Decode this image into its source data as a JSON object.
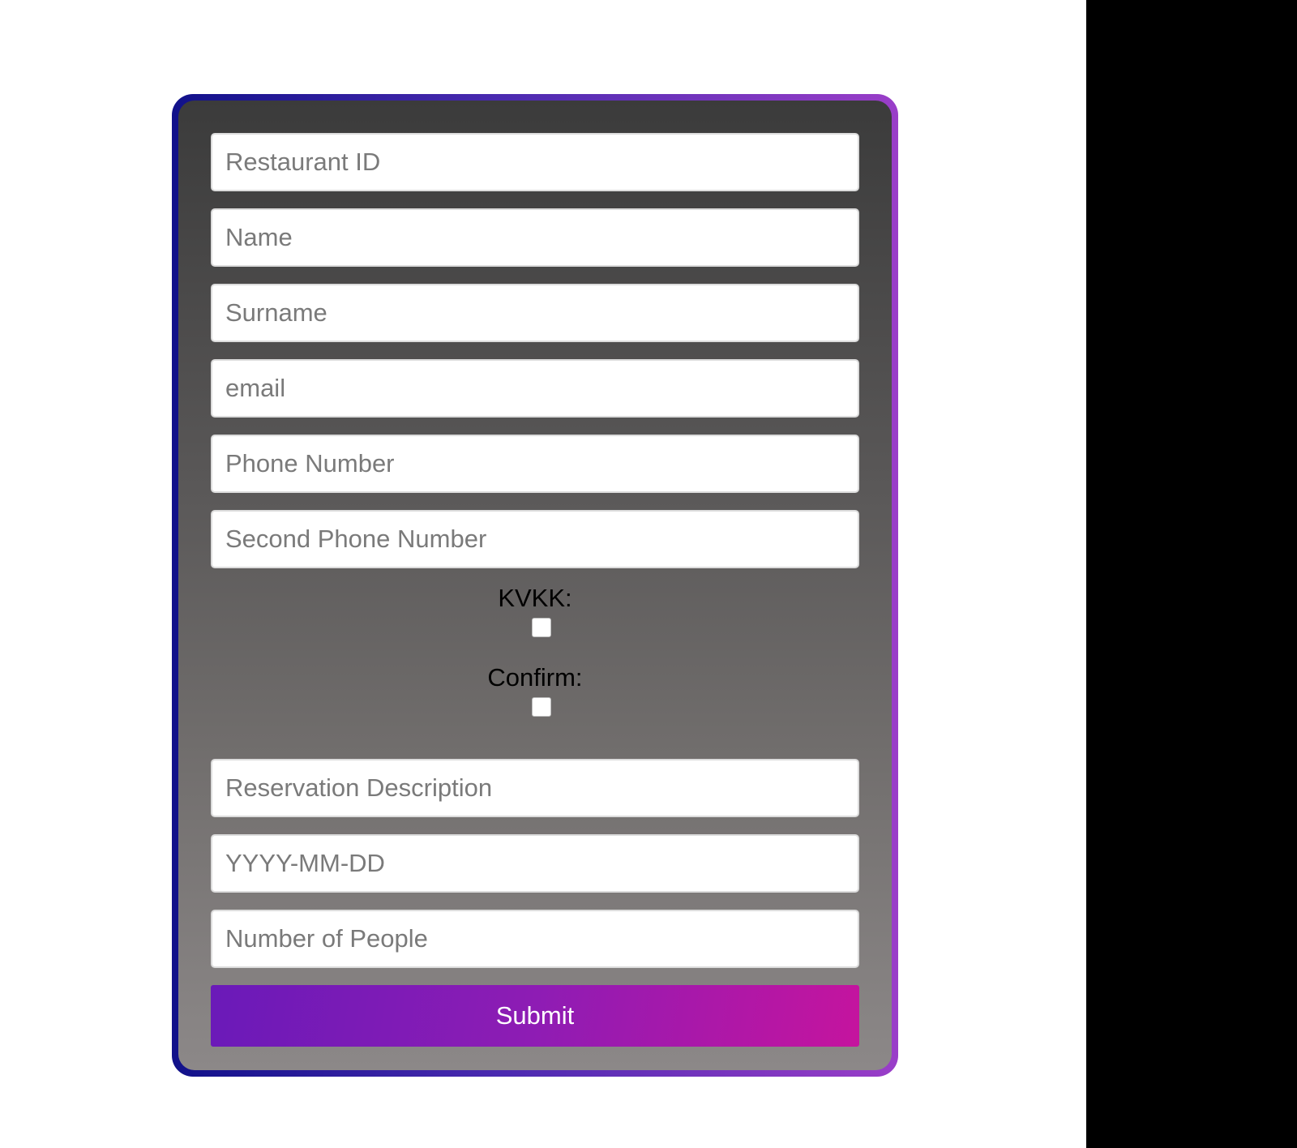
{
  "form": {
    "fields_top": [
      {
        "placeholder": "Restaurant ID"
      },
      {
        "placeholder": "Name"
      },
      {
        "placeholder": "Surname"
      },
      {
        "placeholder": "email"
      },
      {
        "placeholder": "Phone Number"
      },
      {
        "placeholder": "Second Phone Number"
      }
    ],
    "kvkk_label": "KVKK:",
    "confirm_label": "Confirm:",
    "fields_bottom": [
      {
        "placeholder": "Reservation Description"
      },
      {
        "placeholder": "YYYY-MM-DD"
      },
      {
        "placeholder": "Number of People"
      }
    ],
    "submit_label": "Submit"
  },
  "colors": {
    "frame_gradient_start": "#11118a",
    "frame_gradient_end": "#9a3ec8",
    "card_top": "#3b3b3b",
    "card_bottom": "#8c8888",
    "submit_start": "#6a1ab8",
    "submit_end": "#c5149e"
  }
}
